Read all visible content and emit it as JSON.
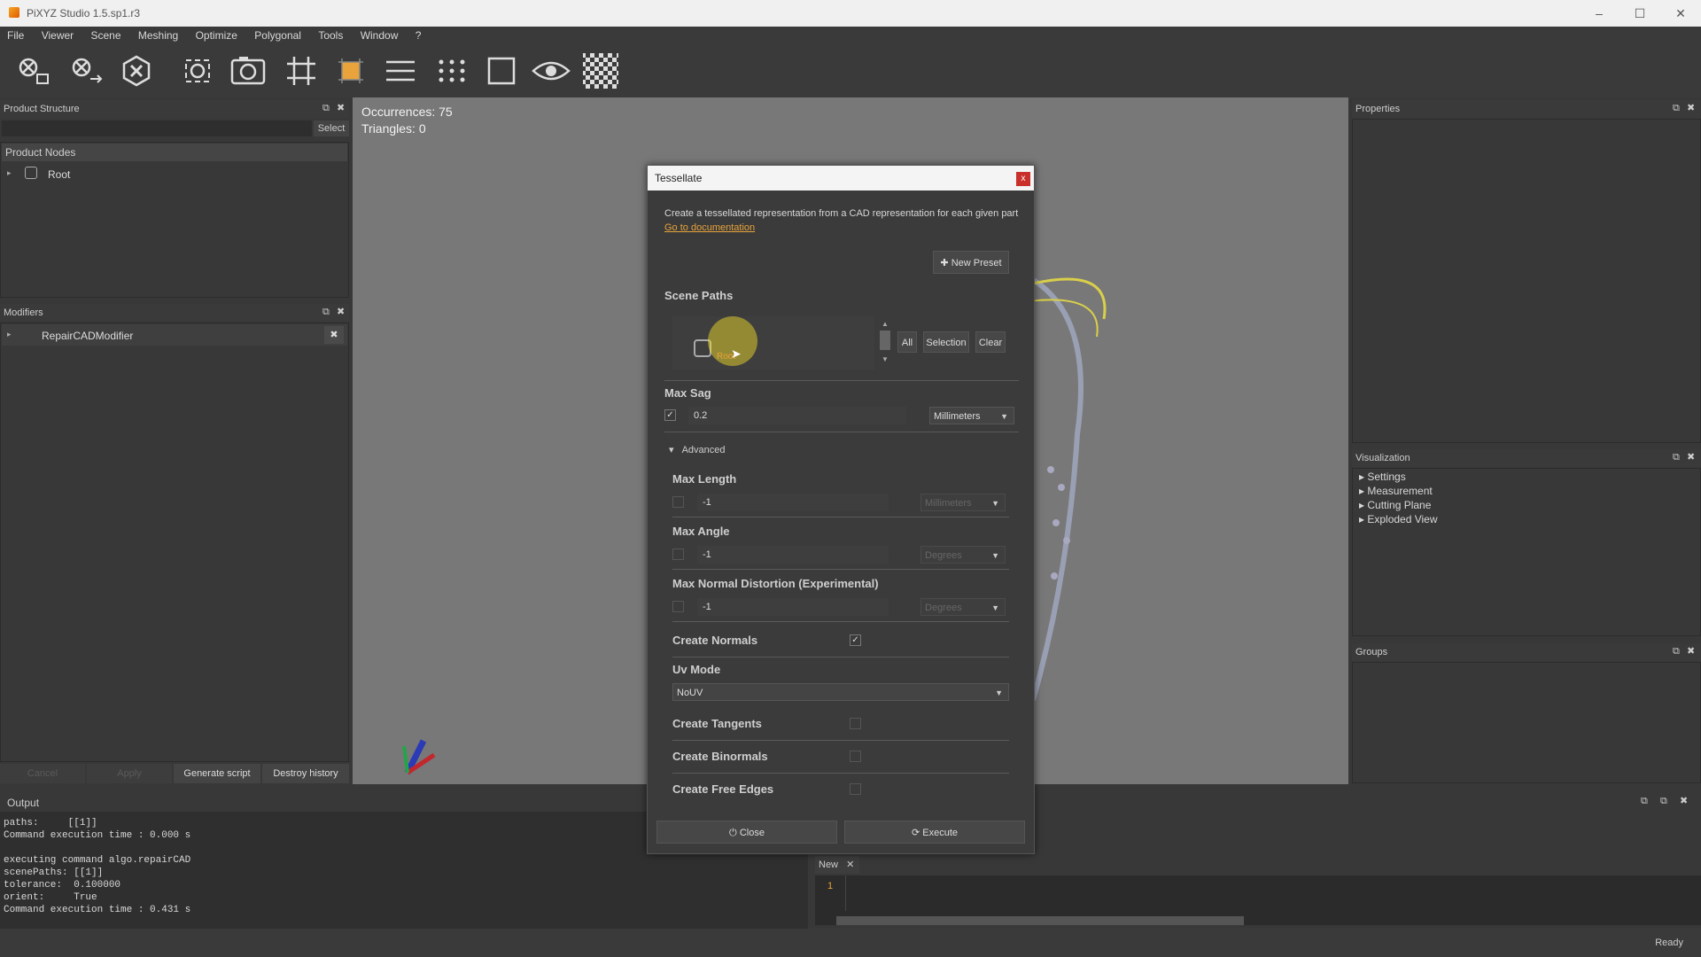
{
  "window": {
    "title": "PiXYZ Studio 1.5.sp1.r3"
  },
  "menu": [
    "File",
    "Viewer",
    "Scene",
    "Meshing",
    "Optimize",
    "Polygonal",
    "Tools",
    "Window",
    "?"
  ],
  "product_structure": {
    "title": "Product Structure",
    "select_label": "Select",
    "section": "Product Nodes",
    "root_label": "Root"
  },
  "modifiers": {
    "title": "Modifiers",
    "item": "RepairCADModifier",
    "buttons": {
      "cancel": "Cancel",
      "apply": "Apply",
      "generate": "Generate script",
      "destroy": "Destroy history"
    }
  },
  "viewport": {
    "occurrences": "Occurrences: 75",
    "triangles": "Triangles: 0"
  },
  "properties": {
    "title": "Properties"
  },
  "visualization": {
    "title": "Visualization",
    "items": [
      "Settings",
      "Measurement",
      "Cutting Plane",
      "Exploded View"
    ]
  },
  "groups": {
    "title": "Groups"
  },
  "dialog": {
    "title": "Tessellate",
    "description": "Create a tessellated representation from a CAD representation for each given part",
    "doc_link": "Go to documentation",
    "new_preset": "New Preset",
    "scene_paths_label": "Scene Paths",
    "scene_root": "Root",
    "btn_all": "All",
    "btn_selection": "Selection",
    "btn_clear": "Clear",
    "max_sag_label": "Max Sag",
    "max_sag_value": "0.2",
    "max_sag_unit": "Millimeters",
    "advanced_label": "Advanced",
    "max_length_label": "Max Length",
    "max_length_value": "-1",
    "max_length_unit": "Millimeters",
    "max_angle_label": "Max Angle",
    "max_angle_value": "-1",
    "max_angle_unit": "Degrees",
    "max_normal_label": "Max Normal Distortion (Experimental)",
    "max_normal_value": "-1",
    "max_normal_unit": "Degrees",
    "create_normals_label": "Create Normals",
    "create_normals_checked": true,
    "uv_mode_label": "Uv Mode",
    "uv_mode_value": "NoUV",
    "create_tangents_label": "Create Tangents",
    "create_binormals_label": "Create Binormals",
    "create_free_edges_label": "Create Free Edges",
    "close_label": "Close",
    "execute_label": "Execute"
  },
  "output": {
    "title": "Output",
    "lines": "paths:     [[1]]\nCommand execution time : 0.000 s\n\nexecuting command algo.repairCAD\nscenePaths: [[1]]\ntolerance:  0.100000\norient:     True\nCommand execution time : 0.431 s"
  },
  "script_editor": {
    "tab_label": "New",
    "line_number": "1"
  },
  "status": {
    "text": "Ready"
  },
  "colors": {
    "accent": "#e8a33a",
    "link": "#e8a33a",
    "close_red": "#c9302c"
  }
}
